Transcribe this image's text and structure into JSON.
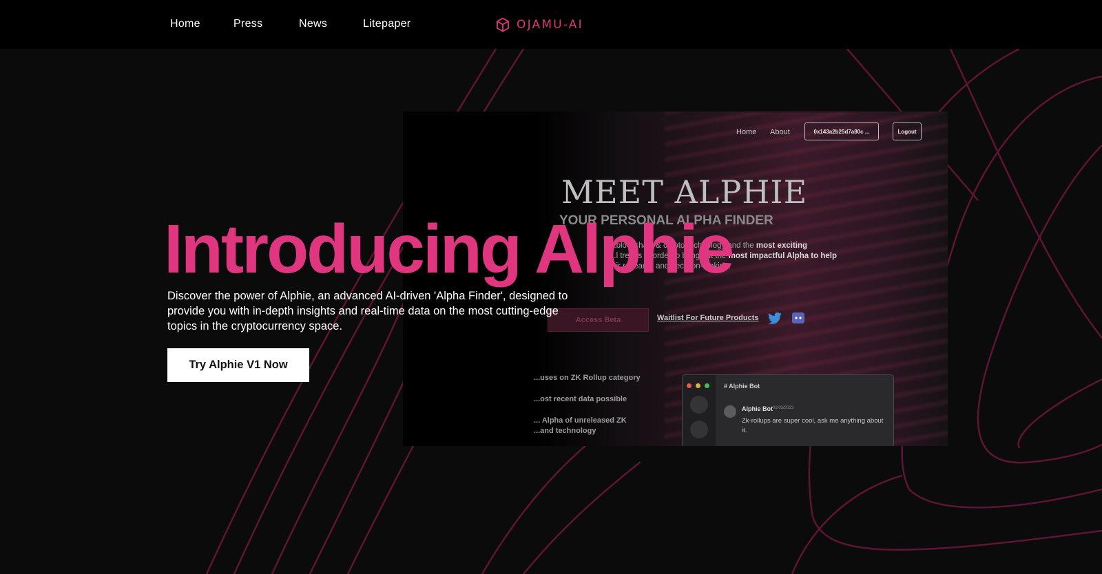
{
  "nav": {
    "links": [
      "Home",
      "Press",
      "News",
      "Litepaper"
    ],
    "brand": "OJAMU-AI"
  },
  "hero": {
    "title": "Introducing Alphie",
    "description": "Discover the power of Alphie, an advanced AI-driven 'Alpha Finder', designed to provide you with in-depth insights and real-time data on the most cutting-edge topics in the cryptocurrency space.",
    "cta_label": "Try Alphie V1 Now"
  },
  "mockup": {
    "nav_links": [
      "Home",
      "About"
    ],
    "wallet": "0x143a2b25d7a80c ...",
    "logout": "Logout",
    "title": "MEET ALPHIE",
    "subtitle": "YOUR PERSONAL ALPHA FINDER",
    "desc_lines": [
      "...blockchain & crypto technology and the",
      "most exciting",
      "...l trends in order to bring out the",
      "most impactful Alpha to help",
      "...ir research and decision-making."
    ],
    "access_label": "Access Beta",
    "waitlist_label": "Waitlist For Future Products",
    "features": [
      "...uses on ZK Rollup category",
      "...ost recent data possible",
      "... Alpha of unreleased ZK",
      "...and technology"
    ],
    "chat": {
      "channel": "Alphie Bot",
      "author": "Alphie Bot",
      "date": "02/03/2023",
      "message": "Zk-rollups are super cool, ask me anything about it."
    }
  },
  "colors": {
    "accent": "#e0357f",
    "background": "#0b0b0c",
    "nav_background": "#000000"
  },
  "icons": [
    "ojamu-logo-icon",
    "twitter-icon",
    "discord-icon"
  ]
}
